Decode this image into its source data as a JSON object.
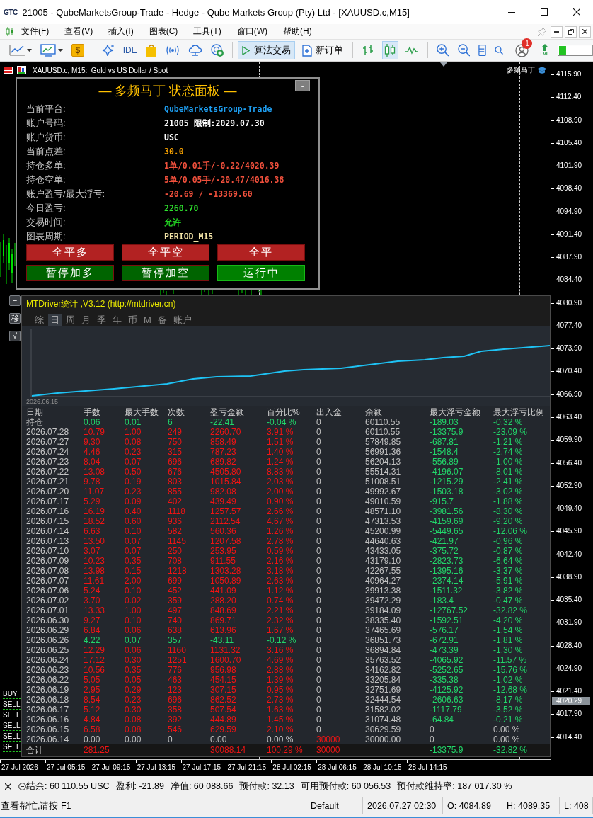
{
  "window": {
    "logo": "GTC",
    "title": "21005 - QubeMarketsGroup-Trade - Hedge - Qube Markets Group (Pty) Ltd - [XAUUSD.c,M15]"
  },
  "menu": [
    "文件(F)",
    "查看(V)",
    "插入(I)",
    "图表(C)",
    "工具(T)",
    "窗口(W)",
    "帮助(H)"
  ],
  "toolbar": {
    "market_symbol": "$",
    "ide_label": "IDE",
    "algo_trading": {
      "label": "算法交易",
      "selected": true
    },
    "new_order": "新订单",
    "chart_modes": [
      {
        "kind": "bars",
        "selected": false
      },
      {
        "kind": "candles",
        "selected": true
      },
      {
        "kind": "line",
        "selected": false
      }
    ],
    "notification_count": "1",
    "level_label": "LVL"
  },
  "chart": {
    "title": "XAUUSD.c, M15:  Gold vs US Dollar / Spot",
    "expert_name": "多频马丁",
    "order_labels": [
      "BUY",
      "SELL",
      "SELL",
      "SELL",
      "SELL",
      "SELL"
    ],
    "price_axis": [
      "4115.90",
      "4112.40",
      "4108.90",
      "4105.40",
      "4101.90",
      "4098.40",
      "4094.90",
      "4091.40",
      "4087.90",
      "4084.40",
      "4080.90",
      "4077.40",
      "4073.90",
      "4070.40",
      "4066.90",
      "4063.40",
      "4059.90",
      "4056.40",
      "4052.90",
      "4049.40",
      "4045.90",
      "4042.40",
      "4038.90",
      "4035.40",
      "4031.90",
      "4028.40",
      "4024.90",
      "4021.40",
      "4017.90",
      "4014.40"
    ],
    "current_price": "4020.29",
    "time_axis": [
      "27 Jul 2026",
      "27 Jul 05:15",
      "27 Jul 09:15",
      "27 Jul 13:15",
      "27 Jul 17:15",
      "27 Jul 21:15",
      "28 Jul 02:15",
      "28 Jul 06:15",
      "28 Jul 10:15",
      "28 Jul 14:15"
    ]
  },
  "status_panel": {
    "title": "— 多频马丁 状态面板 —",
    "collapse_label": "-",
    "fields": [
      {
        "label": "当前平台:",
        "value": "QubeMarketsGroup-Trade",
        "color": "#1e9ff2"
      },
      {
        "label": "账户号码:",
        "value": "21005 限制:2029.07.30",
        "color": "#ffffff"
      },
      {
        "label": "账户货币:",
        "value": "USC",
        "color": "#ffffff"
      },
      {
        "label": "当前点差:",
        "value": "30.0",
        "color": "#f5a000"
      },
      {
        "label": "持仓多单:",
        "value": "1单/0.01手/-0.22/4020.39",
        "color": "#f0503c"
      },
      {
        "label": "持仓空单:",
        "value": "5单/0.05手/-20.47/4016.38",
        "color": "#f0503c"
      },
      {
        "label": "账户盈亏/最大浮亏:",
        "value": "-20.69 / -13369.60",
        "color": "#f0503c"
      },
      {
        "label": "今日盈亏:",
        "value": "2260.70",
        "color": "#2ee02e"
      },
      {
        "label": "交易时间:",
        "value": "允许",
        "color": "#22d022"
      },
      {
        "label": "图表周期:",
        "value": "PERIOD_M15",
        "color": "#f2e3a6"
      }
    ],
    "buttons": [
      {
        "label": "全平多",
        "color": "#b22222",
        "on": false
      },
      {
        "label": "全平空",
        "color": "#b22222",
        "on": false
      },
      {
        "label": "全平",
        "color": "#b22222",
        "on": false
      },
      {
        "label": "暂停加多",
        "color": "#006400",
        "on": false
      },
      {
        "label": "暂停加空",
        "color": "#006400",
        "on": false
      },
      {
        "label": "运行中",
        "color": "#008000",
        "on": true
      }
    ]
  },
  "stats_panel": {
    "side_buttons": [
      "−",
      "移",
      "√"
    ],
    "title": "MTDriver统计 ,V3.12 (http://mtdriver.cn)",
    "tabs": [
      {
        "label": "综",
        "selected": false
      },
      {
        "label": "日",
        "selected": true
      },
      {
        "label": "周",
        "selected": false
      },
      {
        "label": "月",
        "selected": false
      },
      {
        "label": "季",
        "selected": false
      },
      {
        "label": "年",
        "selected": false
      },
      {
        "label": "币",
        "selected": false
      },
      {
        "label": "M",
        "selected": false
      },
      {
        "label": "备",
        "selected": false
      },
      {
        "label": "账户",
        "selected": false
      }
    ],
    "chart_start_label": "2026.06.15",
    "columns": [
      "日期",
      "手数",
      "最大手数",
      "次数",
      "盈亏金额",
      "百分比%",
      "出入金",
      "余额",
      "最大浮亏金额",
      "最大浮亏比例"
    ],
    "rows": [
      {
        "cells": [
          "持仓",
          "0.06",
          "0.01",
          "6",
          "-22.41",
          "-0.04 %",
          "0",
          "60110.55",
          "-189.03",
          "-0.32 %"
        ],
        "kind": "loss",
        "drawdown": true,
        "deposit": false
      },
      {
        "cells": [
          "2026.07.28",
          "10.79",
          "1.00",
          "249",
          "2260.70",
          "3.91 %",
          "0",
          "60110.55",
          "-13375.9",
          "-23.09 %"
        ],
        "kind": "gain",
        "drawdown": true,
        "deposit": false
      },
      {
        "cells": [
          "2026.07.27",
          "9.30",
          "0.08",
          "750",
          "858.49",
          "1.51 %",
          "0",
          "57849.85",
          "-687.81",
          "-1.21 %"
        ],
        "kind": "gain",
        "drawdown": true,
        "deposit": false
      },
      {
        "cells": [
          "2026.07.24",
          "4.46",
          "0.23",
          "315",
          "787.23",
          "1.40 %",
          "0",
          "56991.36",
          "-1548.4",
          "-2.74 %"
        ],
        "kind": "gain",
        "drawdown": true,
        "deposit": false
      },
      {
        "cells": [
          "2026.07.23",
          "8.04",
          "0.07",
          "696",
          "689.82",
          "1.24 %",
          "0",
          "56204.13",
          "-556.89",
          "-1.00 %"
        ],
        "kind": "gain",
        "drawdown": true,
        "deposit": false
      },
      {
        "cells": [
          "2026.07.22",
          "13.08",
          "0.50",
          "676",
          "4505.80",
          "8.83 %",
          "0",
          "55514.31",
          "-4196.07",
          "-8.01 %"
        ],
        "kind": "gain",
        "drawdown": true,
        "deposit": false
      },
      {
        "cells": [
          "2026.07.21",
          "9.78",
          "0.19",
          "803",
          "1015.84",
          "2.03 %",
          "0",
          "51008.51",
          "-1215.29",
          "-2.41 %"
        ],
        "kind": "gain",
        "drawdown": true,
        "deposit": false
      },
      {
        "cells": [
          "2026.07.20",
          "11.07",
          "0.23",
          "855",
          "982.08",
          "2.00 %",
          "0",
          "49992.67",
          "-1503.18",
          "-3.02 %"
        ],
        "kind": "gain",
        "drawdown": true,
        "deposit": false
      },
      {
        "cells": [
          "2026.07.17",
          "5.29",
          "0.09",
          "402",
          "439.49",
          "0.90 %",
          "0",
          "49010.59",
          "-915.7",
          "-1.88 %"
        ],
        "kind": "gain",
        "drawdown": true,
        "deposit": false
      },
      {
        "cells": [
          "2026.07.16",
          "16.19",
          "0.40",
          "1118",
          "1257.57",
          "2.66 %",
          "0",
          "48571.10",
          "-3981.56",
          "-8.30 %"
        ],
        "kind": "gain",
        "drawdown": true,
        "deposit": false
      },
      {
        "cells": [
          "2026.07.15",
          "18.52",
          "0.60",
          "936",
          "2112.54",
          "4.67 %",
          "0",
          "47313.53",
          "-4159.69",
          "-9.20 %"
        ],
        "kind": "gain",
        "drawdown": true,
        "deposit": false
      },
      {
        "cells": [
          "2026.07.14",
          "6.63",
          "0.10",
          "582",
          "560.36",
          "1.26 %",
          "0",
          "45200.99",
          "-5449.65",
          "-12.06 %"
        ],
        "kind": "gain",
        "drawdown": true,
        "deposit": false
      },
      {
        "cells": [
          "2026.07.13",
          "13.50",
          "0.07",
          "1145",
          "1207.58",
          "2.78 %",
          "0",
          "44640.63",
          "-421.97",
          "-0.96 %"
        ],
        "kind": "gain",
        "drawdown": true,
        "deposit": false
      },
      {
        "cells": [
          "2026.07.10",
          "3.07",
          "0.07",
          "250",
          "253.95",
          "0.59 %",
          "0",
          "43433.05",
          "-375.72",
          "-0.87 %"
        ],
        "kind": "gain",
        "drawdown": true,
        "deposit": false
      },
      {
        "cells": [
          "2026.07.09",
          "10.23",
          "0.35",
          "708",
          "911.55",
          "2.16 %",
          "0",
          "43179.10",
          "-2823.73",
          "-6.64 %"
        ],
        "kind": "gain",
        "drawdown": true,
        "deposit": false
      },
      {
        "cells": [
          "2026.07.08",
          "13.98",
          "0.15",
          "1218",
          "1303.28",
          "3.18 %",
          "0",
          "42267.55",
          "-1395.16",
          "-3.37 %"
        ],
        "kind": "gain",
        "drawdown": true,
        "deposit": false
      },
      {
        "cells": [
          "2026.07.07",
          "11.61",
          "2.00",
          "699",
          "1050.89",
          "2.63 %",
          "0",
          "40964.27",
          "-2374.14",
          "-5.91 %"
        ],
        "kind": "gain",
        "drawdown": true,
        "deposit": false
      },
      {
        "cells": [
          "2026.07.06",
          "5.24",
          "0.10",
          "452",
          "441.09",
          "1.12 %",
          "0",
          "39913.38",
          "-1511.32",
          "-3.82 %"
        ],
        "kind": "gain",
        "drawdown": true,
        "deposit": false
      },
      {
        "cells": [
          "2026.07.02",
          "3.70",
          "0.02",
          "359",
          "288.20",
          "0.74 %",
          "0",
          "39472.29",
          "-183.4",
          "-0.47 %"
        ],
        "kind": "gain",
        "drawdown": true,
        "deposit": false
      },
      {
        "cells": [
          "2026.07.01",
          "13.33",
          "1.00",
          "497",
          "848.69",
          "2.21 %",
          "0",
          "39184.09",
          "-12767.52",
          "-32.82 %"
        ],
        "kind": "gain",
        "drawdown": true,
        "deposit": false
      },
      {
        "cells": [
          "2026.06.30",
          "9.27",
          "0.10",
          "740",
          "869.71",
          "2.32 %",
          "0",
          "38335.40",
          "-1592.51",
          "-4.20 %"
        ],
        "kind": "gain",
        "drawdown": true,
        "deposit": false
      },
      {
        "cells": [
          "2026.06.29",
          "6.84",
          "0.06",
          "638",
          "613.96",
          "1.67 %",
          "0",
          "37465.69",
          "-576.17",
          "-1.54 %"
        ],
        "kind": "gain",
        "drawdown": true,
        "deposit": false
      },
      {
        "cells": [
          "2026.06.26",
          "4.22",
          "0.07",
          "357",
          "-43.11",
          "-0.12 %",
          "0",
          "36851.73",
          "-672.91",
          "-1.81 %"
        ],
        "kind": "loss",
        "drawdown": true,
        "deposit": false
      },
      {
        "cells": [
          "2026.06.25",
          "12.29",
          "0.06",
          "1160",
          "1131.32",
          "3.16 %",
          "0",
          "36894.84",
          "-473.39",
          "-1.30 %"
        ],
        "kind": "gain",
        "drawdown": true,
        "deposit": false
      },
      {
        "cells": [
          "2026.06.24",
          "17.12",
          "0.30",
          "1251",
          "1600.70",
          "4.69 %",
          "0",
          "35763.52",
          "-4065.92",
          "-11.57 %"
        ],
        "kind": "gain",
        "drawdown": true,
        "deposit": false
      },
      {
        "cells": [
          "2026.06.23",
          "10.56",
          "0.35",
          "776",
          "956.98",
          "2.88 %",
          "0",
          "34162.82",
          "-5252.65",
          "-15.76 %"
        ],
        "kind": "gain",
        "drawdown": true,
        "deposit": false
      },
      {
        "cells": [
          "2026.06.22",
          "5.05",
          "0.05",
          "463",
          "454.15",
          "1.39 %",
          "0",
          "33205.84",
          "-335.38",
          "-1.02 %"
        ],
        "kind": "gain",
        "drawdown": true,
        "deposit": false
      },
      {
        "cells": [
          "2026.06.19",
          "2.95",
          "0.29",
          "123",
          "307.15",
          "0.95 %",
          "0",
          "32751.69",
          "-4125.92",
          "-12.68 %"
        ],
        "kind": "gain",
        "drawdown": true,
        "deposit": false
      },
      {
        "cells": [
          "2026.06.18",
          "8.54",
          "0.23",
          "696",
          "862.52",
          "2.73 %",
          "0",
          "32444.54",
          "-2606.63",
          "-8.17 %"
        ],
        "kind": "gain",
        "drawdown": true,
        "deposit": false
      },
      {
        "cells": [
          "2026.06.17",
          "5.12",
          "0.30",
          "358",
          "507.54",
          "1.63 %",
          "0",
          "31582.02",
          "-1117.79",
          "-3.52 %"
        ],
        "kind": "gain",
        "drawdown": true,
        "deposit": false
      },
      {
        "cells": [
          "2026.06.16",
          "4.84",
          "0.08",
          "392",
          "444.89",
          "1.45 %",
          "0",
          "31074.48",
          "-64.84",
          "-0.21 %"
        ],
        "kind": "gain",
        "drawdown": true,
        "deposit": false
      },
      {
        "cells": [
          "2026.06.15",
          "6.58",
          "0.08",
          "546",
          "629.59",
          "2.10 %",
          "0",
          "30629.59",
          "0",
          "0.00 %"
        ],
        "kind": "gain",
        "drawdown": false,
        "deposit": false
      },
      {
        "cells": [
          "2026.06.14",
          "0.00",
          "0.00",
          "0",
          "0.00",
          "0.00 %",
          "30000",
          "30000.00",
          "0",
          "0.00 %"
        ],
        "kind": "flat",
        "drawdown": false,
        "deposit": true
      }
    ],
    "total": {
      "label": "合计",
      "lots": "281.25",
      "profit": "30088.14",
      "percent": "100.29 %",
      "deposit": "30000",
      "max_float": "-13375.9",
      "max_float_pct": "-32.82 %"
    }
  },
  "terminal": [
    "结余: 60 110.55 USC",
    "盈利: -21.89",
    "净值: 60 088.66",
    "预付款: 32.13",
    "可用预付款: 60 056.53",
    "预付款维持率: 187 017.30 %"
  ],
  "status_bar": [
    "查看帮忙,请按 F1",
    "Default",
    "2026.07.27 02:30",
    "O: 4084.89",
    "H: 4089.35",
    "L: 408"
  ]
}
